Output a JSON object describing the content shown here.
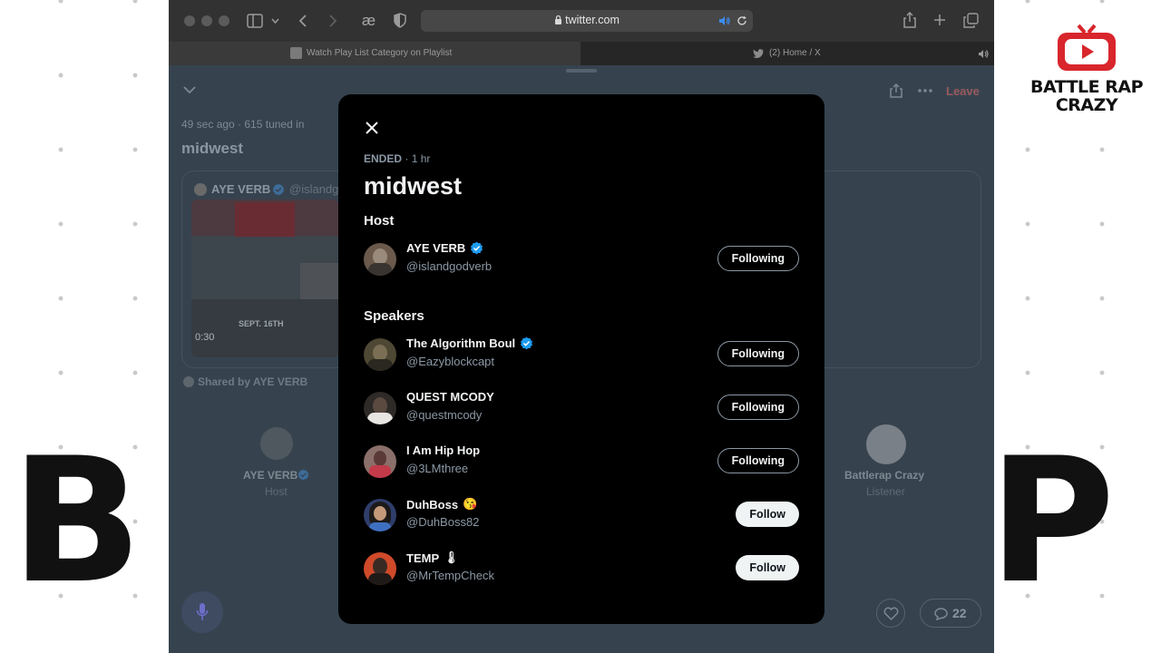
{
  "browser": {
    "url": "twitter.com",
    "tabs": [
      {
        "label": "Watch Play List Category on Playlist"
      },
      {
        "label": "(2) Home / X"
      }
    ]
  },
  "overlay": {
    "big_left": "B",
    "big_right": "P",
    "brand_line1": "BATTLE RAP",
    "brand_line2": "CRAZY"
  },
  "space": {
    "meta": "49 sec ago · 615 tuned in",
    "title": "midwest",
    "leave_label": "Leave",
    "card_host_name": "AYE VERB",
    "card_host_handle": "@islandg",
    "thumb_date": "SEPT. 16TH",
    "thumb_time": "0:30",
    "shared_by": "Shared by AYE VERB",
    "host_name": "AYE VERB",
    "host_role": "Host",
    "listener_name": "Battlerap Crazy",
    "listener_role": "Listener",
    "chat_count": "22"
  },
  "modal": {
    "status_label": "ENDED",
    "status_duration": "· 1 hr",
    "title": "midwest",
    "host_heading": "Host",
    "speakers_heading": "Speakers",
    "host": {
      "name": "AYE VERB",
      "handle": "@islandgodverb",
      "verified": true,
      "button": "Following",
      "avatar_color": "#6b5a4c"
    },
    "speakers": [
      {
        "name": "The Algorithm Boul",
        "handle": "@Eazyblockcapt",
        "verified": true,
        "emoji": "",
        "button": "Following",
        "avatar_color": "#4d4733"
      },
      {
        "name": "QUEST MCODY",
        "handle": "@questmcody",
        "verified": false,
        "emoji": "",
        "button": "Following",
        "avatar_color": "#2e2a28"
      },
      {
        "name": "I Am Hip Hop",
        "handle": "@3LMthree",
        "verified": false,
        "emoji": "",
        "button": "Following",
        "avatar_color": "#8a6f6a"
      },
      {
        "name": "DuhBoss",
        "handle": "@DuhBoss82",
        "verified": false,
        "emoji": "😘",
        "button": "Follow",
        "avatar_color": "#2f3d6a"
      },
      {
        "name": "TEMP",
        "handle": "@MrTempCheck",
        "verified": false,
        "emoji": "🌡",
        "button": "Follow",
        "avatar_color": "#d04a2a"
      }
    ]
  }
}
